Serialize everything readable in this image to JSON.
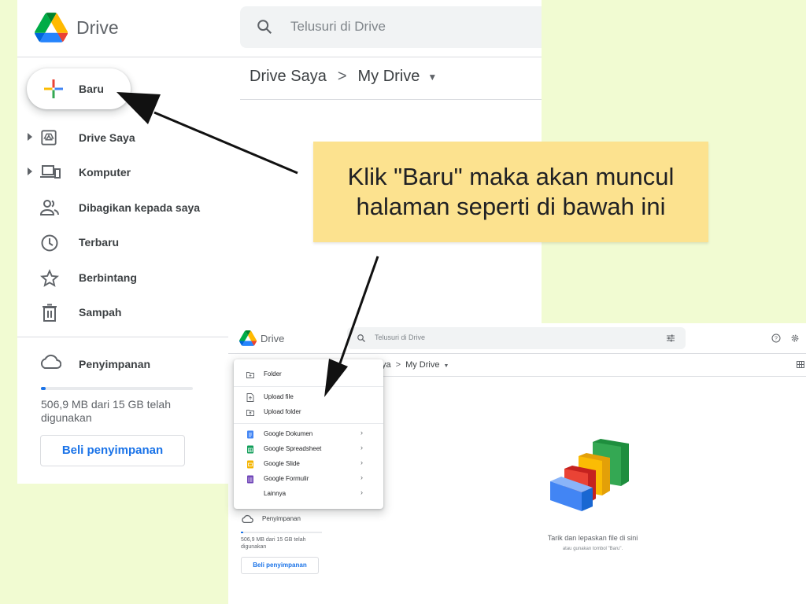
{
  "screenshot_large": {
    "app_name": "Drive",
    "search_placeholder": "Telusuri di Drive",
    "breadcrumb": {
      "root": "Drive Saya",
      "separator": ">",
      "current": "My Drive"
    },
    "new_button": "Baru",
    "nav": [
      {
        "label": "Drive Saya",
        "icon": "drive-icon",
        "expandable": true
      },
      {
        "label": "Komputer",
        "icon": "computer-icon",
        "expandable": true
      },
      {
        "label": "Dibagikan kepada saya",
        "icon": "shared-people-icon",
        "expandable": false
      },
      {
        "label": "Terbaru",
        "icon": "clock-icon",
        "expandable": false
      },
      {
        "label": "Berbintang",
        "icon": "star-icon",
        "expandable": false
      },
      {
        "label": "Sampah",
        "icon": "trash-icon",
        "expandable": false
      }
    ],
    "storage": {
      "label": "Penyimpanan",
      "used_fraction": 0.033,
      "text": "506,9 MB dari 15 GB telah digunakan",
      "button": "Beli penyimpanan"
    }
  },
  "callout": {
    "line1": "Klik \"Baru\" maka akan muncul",
    "line2": "halaman seperti di bawah ini"
  },
  "screenshot_small": {
    "app_name": "Drive",
    "search_placeholder": "Telusuri di Drive",
    "breadcrumb": {
      "partial": "ya",
      "separator": ">",
      "current": "My Drive"
    },
    "new_menu": {
      "items": [
        {
          "label": "Folder",
          "icon": "new-folder-icon",
          "submenu": false
        },
        {
          "label": "Upload file",
          "icon": "upload-file-icon",
          "submenu": false
        },
        {
          "label": "Upload folder",
          "icon": "upload-folder-icon",
          "submenu": false
        },
        {
          "label": "Google Dokumen",
          "icon": "docs-icon",
          "color": "#4285f4",
          "submenu": true
        },
        {
          "label": "Google Spreadsheet",
          "icon": "sheets-icon",
          "color": "#0f9d58",
          "submenu": true
        },
        {
          "label": "Google Slide",
          "icon": "slides-icon",
          "color": "#f4b400",
          "submenu": true
        },
        {
          "label": "Google Formulir",
          "icon": "forms-icon",
          "color": "#7248b9",
          "submenu": true
        },
        {
          "label": "Lainnya",
          "icon": "",
          "submenu": true
        }
      ]
    },
    "storage": {
      "label": "Penyimpanan",
      "used_fraction": 0.033,
      "text": "506,9 MB dari 15 GB telah digunakan",
      "button": "Beli penyimpanan"
    },
    "empty_state": {
      "title": "Tarik dan lepaskan file di sini",
      "subtitle": "atau gunakan tombol \"Baru\"."
    }
  },
  "colors": {
    "background": "#f1fbd2",
    "callout": "#fce28f",
    "accent_blue": "#1a73e8"
  }
}
